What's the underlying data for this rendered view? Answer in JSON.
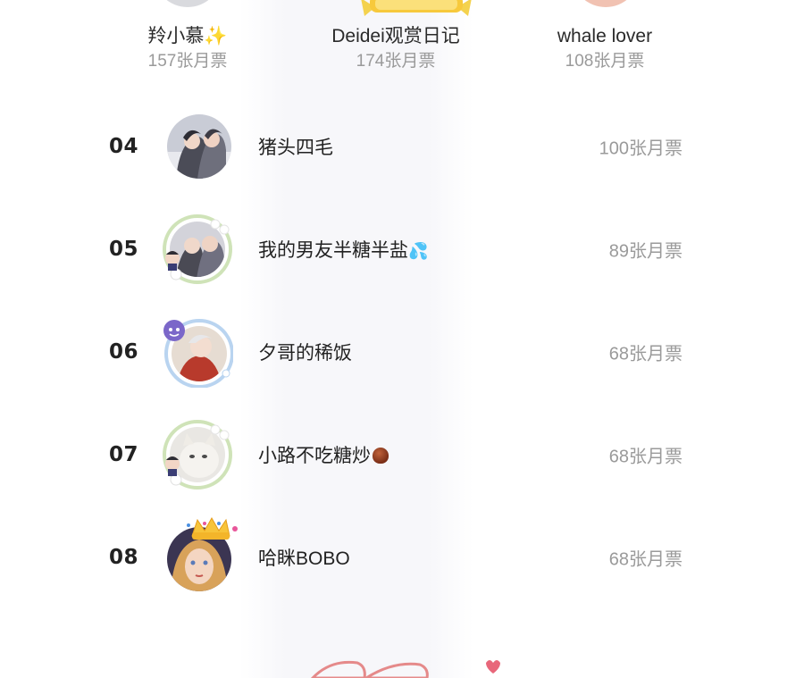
{
  "podium": [
    {
      "name": "羚小慕",
      "emoji": "✨",
      "votes": "157张月票"
    },
    {
      "name": "Deidei观赏日记",
      "votes": "174张月票"
    },
    {
      "name": "whale lover",
      "votes": "108张月票"
    }
  ],
  "rank_list": [
    {
      "rank": "04",
      "name": "猪头四毛",
      "votes": "100张月票",
      "avatar_icon": "couple-avatar-icon"
    },
    {
      "rank": "05",
      "name": "我的男友半糖半盐",
      "emoji": "💦",
      "votes": "89张月票",
      "avatar_icon": "framed-couple-avatar-icon"
    },
    {
      "rank": "06",
      "name": "夕哥的稀饭",
      "votes": "68张月票",
      "avatar_icon": "framed-character-avatar-icon"
    },
    {
      "rank": "07",
      "name": "小路不吃糖炒",
      "emoji": "🌰",
      "votes": "68张月票",
      "avatar_icon": "framed-cat-avatar-icon"
    },
    {
      "rank": "08",
      "name": "哈眯BOBO",
      "votes": "68张月票",
      "avatar_icon": "crowned-avatar-icon"
    }
  ],
  "colors": {
    "text_primary": "#222222",
    "text_secondary": "#9a9a9a",
    "crown_gold": "#f3c233"
  }
}
